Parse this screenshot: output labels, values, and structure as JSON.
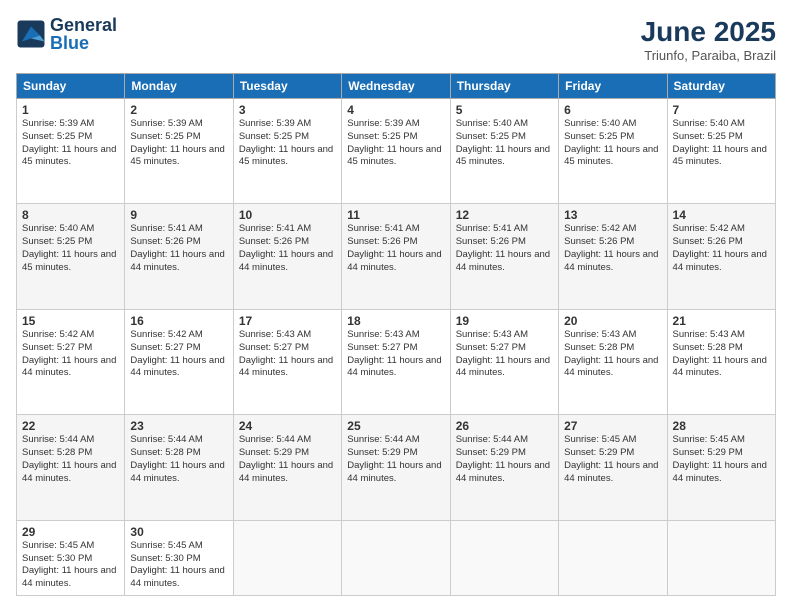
{
  "logo": {
    "text_general": "General",
    "text_blue": "Blue"
  },
  "title": "June 2025",
  "subtitle": "Triunfo, Paraiba, Brazil",
  "headers": [
    "Sunday",
    "Monday",
    "Tuesday",
    "Wednesday",
    "Thursday",
    "Friday",
    "Saturday"
  ],
  "weeks": [
    [
      {
        "day": "1",
        "sunrise": "Sunrise: 5:39 AM",
        "sunset": "Sunset: 5:25 PM",
        "daylight": "Daylight: 11 hours and 45 minutes."
      },
      {
        "day": "2",
        "sunrise": "Sunrise: 5:39 AM",
        "sunset": "Sunset: 5:25 PM",
        "daylight": "Daylight: 11 hours and 45 minutes."
      },
      {
        "day": "3",
        "sunrise": "Sunrise: 5:39 AM",
        "sunset": "Sunset: 5:25 PM",
        "daylight": "Daylight: 11 hours and 45 minutes."
      },
      {
        "day": "4",
        "sunrise": "Sunrise: 5:39 AM",
        "sunset": "Sunset: 5:25 PM",
        "daylight": "Daylight: 11 hours and 45 minutes."
      },
      {
        "day": "5",
        "sunrise": "Sunrise: 5:40 AM",
        "sunset": "Sunset: 5:25 PM",
        "daylight": "Daylight: 11 hours and 45 minutes."
      },
      {
        "day": "6",
        "sunrise": "Sunrise: 5:40 AM",
        "sunset": "Sunset: 5:25 PM",
        "daylight": "Daylight: 11 hours and 45 minutes."
      },
      {
        "day": "7",
        "sunrise": "Sunrise: 5:40 AM",
        "sunset": "Sunset: 5:25 PM",
        "daylight": "Daylight: 11 hours and 45 minutes."
      }
    ],
    [
      {
        "day": "8",
        "sunrise": "Sunrise: 5:40 AM",
        "sunset": "Sunset: 5:25 PM",
        "daylight": "Daylight: 11 hours and 45 minutes."
      },
      {
        "day": "9",
        "sunrise": "Sunrise: 5:41 AM",
        "sunset": "Sunset: 5:26 PM",
        "daylight": "Daylight: 11 hours and 44 minutes."
      },
      {
        "day": "10",
        "sunrise": "Sunrise: 5:41 AM",
        "sunset": "Sunset: 5:26 PM",
        "daylight": "Daylight: 11 hours and 44 minutes."
      },
      {
        "day": "11",
        "sunrise": "Sunrise: 5:41 AM",
        "sunset": "Sunset: 5:26 PM",
        "daylight": "Daylight: 11 hours and 44 minutes."
      },
      {
        "day": "12",
        "sunrise": "Sunrise: 5:41 AM",
        "sunset": "Sunset: 5:26 PM",
        "daylight": "Daylight: 11 hours and 44 minutes."
      },
      {
        "day": "13",
        "sunrise": "Sunrise: 5:42 AM",
        "sunset": "Sunset: 5:26 PM",
        "daylight": "Daylight: 11 hours and 44 minutes."
      },
      {
        "day": "14",
        "sunrise": "Sunrise: 5:42 AM",
        "sunset": "Sunset: 5:26 PM",
        "daylight": "Daylight: 11 hours and 44 minutes."
      }
    ],
    [
      {
        "day": "15",
        "sunrise": "Sunrise: 5:42 AM",
        "sunset": "Sunset: 5:27 PM",
        "daylight": "Daylight: 11 hours and 44 minutes."
      },
      {
        "day": "16",
        "sunrise": "Sunrise: 5:42 AM",
        "sunset": "Sunset: 5:27 PM",
        "daylight": "Daylight: 11 hours and 44 minutes."
      },
      {
        "day": "17",
        "sunrise": "Sunrise: 5:43 AM",
        "sunset": "Sunset: 5:27 PM",
        "daylight": "Daylight: 11 hours and 44 minutes."
      },
      {
        "day": "18",
        "sunrise": "Sunrise: 5:43 AM",
        "sunset": "Sunset: 5:27 PM",
        "daylight": "Daylight: 11 hours and 44 minutes."
      },
      {
        "day": "19",
        "sunrise": "Sunrise: 5:43 AM",
        "sunset": "Sunset: 5:27 PM",
        "daylight": "Daylight: 11 hours and 44 minutes."
      },
      {
        "day": "20",
        "sunrise": "Sunrise: 5:43 AM",
        "sunset": "Sunset: 5:28 PM",
        "daylight": "Daylight: 11 hours and 44 minutes."
      },
      {
        "day": "21",
        "sunrise": "Sunrise: 5:43 AM",
        "sunset": "Sunset: 5:28 PM",
        "daylight": "Daylight: 11 hours and 44 minutes."
      }
    ],
    [
      {
        "day": "22",
        "sunrise": "Sunrise: 5:44 AM",
        "sunset": "Sunset: 5:28 PM",
        "daylight": "Daylight: 11 hours and 44 minutes."
      },
      {
        "day": "23",
        "sunrise": "Sunrise: 5:44 AM",
        "sunset": "Sunset: 5:28 PM",
        "daylight": "Daylight: 11 hours and 44 minutes."
      },
      {
        "day": "24",
        "sunrise": "Sunrise: 5:44 AM",
        "sunset": "Sunset: 5:29 PM",
        "daylight": "Daylight: 11 hours and 44 minutes."
      },
      {
        "day": "25",
        "sunrise": "Sunrise: 5:44 AM",
        "sunset": "Sunset: 5:29 PM",
        "daylight": "Daylight: 11 hours and 44 minutes."
      },
      {
        "day": "26",
        "sunrise": "Sunrise: 5:44 AM",
        "sunset": "Sunset: 5:29 PM",
        "daylight": "Daylight: 11 hours and 44 minutes."
      },
      {
        "day": "27",
        "sunrise": "Sunrise: 5:45 AM",
        "sunset": "Sunset: 5:29 PM",
        "daylight": "Daylight: 11 hours and 44 minutes."
      },
      {
        "day": "28",
        "sunrise": "Sunrise: 5:45 AM",
        "sunset": "Sunset: 5:29 PM",
        "daylight": "Daylight: 11 hours and 44 minutes."
      }
    ],
    [
      {
        "day": "29",
        "sunrise": "Sunrise: 5:45 AM",
        "sunset": "Sunset: 5:30 PM",
        "daylight": "Daylight: 11 hours and 44 minutes."
      },
      {
        "day": "30",
        "sunrise": "Sunrise: 5:45 AM",
        "sunset": "Sunset: 5:30 PM",
        "daylight": "Daylight: 11 hours and 44 minutes."
      },
      null,
      null,
      null,
      null,
      null
    ]
  ]
}
